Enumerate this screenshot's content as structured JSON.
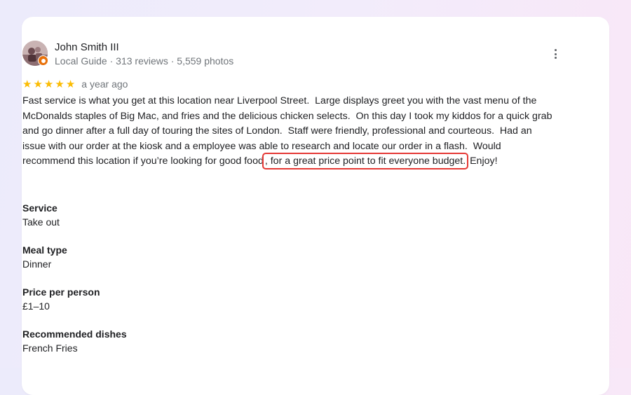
{
  "review": {
    "author": {
      "name": "John Smith III",
      "meta": "Local Guide · 313 reviews · 5,559 photos",
      "badge": "local-guide-badge-icon"
    },
    "rating": {
      "stars": 5,
      "star_glyph": "★",
      "time_ago": "a year ago"
    },
    "text_lines": [
      "Fast service is what you get at this location near Liverpool Street.  Large displays greet you with the vast menu of the",
      "McDonalds staples of Big Mac, and fries and the delicious chicken selects.  On this day I took my kiddos for a quick grab",
      "and go dinner after a full day of touring the sites of London.  Staff were friendly, professional and courteous.  Had an",
      "issue with our order at the kiosk and a employee was able to research and locate our order in a flash.  Would"
    ],
    "last_line": {
      "before": "recommend this location if you’re looking for good food",
      "highlighted": ", for a great price point to fit everyone budget.",
      "after": " Enjoy!"
    },
    "attributes": [
      {
        "label": "Service",
        "value": "Take out"
      },
      {
        "label": "Meal type",
        "value": "Dinner"
      },
      {
        "label": "Price per person",
        "value": "£1–10"
      },
      {
        "label": "Recommended dishes",
        "value": "French Fries"
      }
    ],
    "more_options_icon": "more-vert-icon"
  },
  "colors": {
    "star": "#fbbc04",
    "highlight_border": "#e53935",
    "meta_text": "#70757a",
    "badge": "#e8710a"
  }
}
